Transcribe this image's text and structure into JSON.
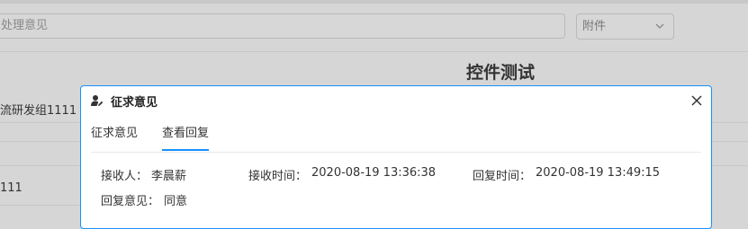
{
  "background": {
    "search_placeholder": "处理意见",
    "select_value": "附件",
    "page_title": "控件测试",
    "row1_text": "流研发组1111",
    "row2_text": "111"
  },
  "modal": {
    "title": "征求意见",
    "tabs": [
      {
        "label": "征求意见",
        "active": false
      },
      {
        "label": "查看回复",
        "active": true
      }
    ],
    "fields": {
      "receiver_label": "接收人：",
      "receiver_value": "李晨薪",
      "receive_time_label": "接收时间：",
      "receive_time_value": "2020-08-19 13:36:38",
      "reply_time_label": "回复时间：",
      "reply_time_value": "2020-08-19 13:49:15",
      "reply_opinion_label": "回复意见：",
      "reply_opinion_value": "同意"
    }
  },
  "colors": {
    "accent": "#1890ff"
  }
}
